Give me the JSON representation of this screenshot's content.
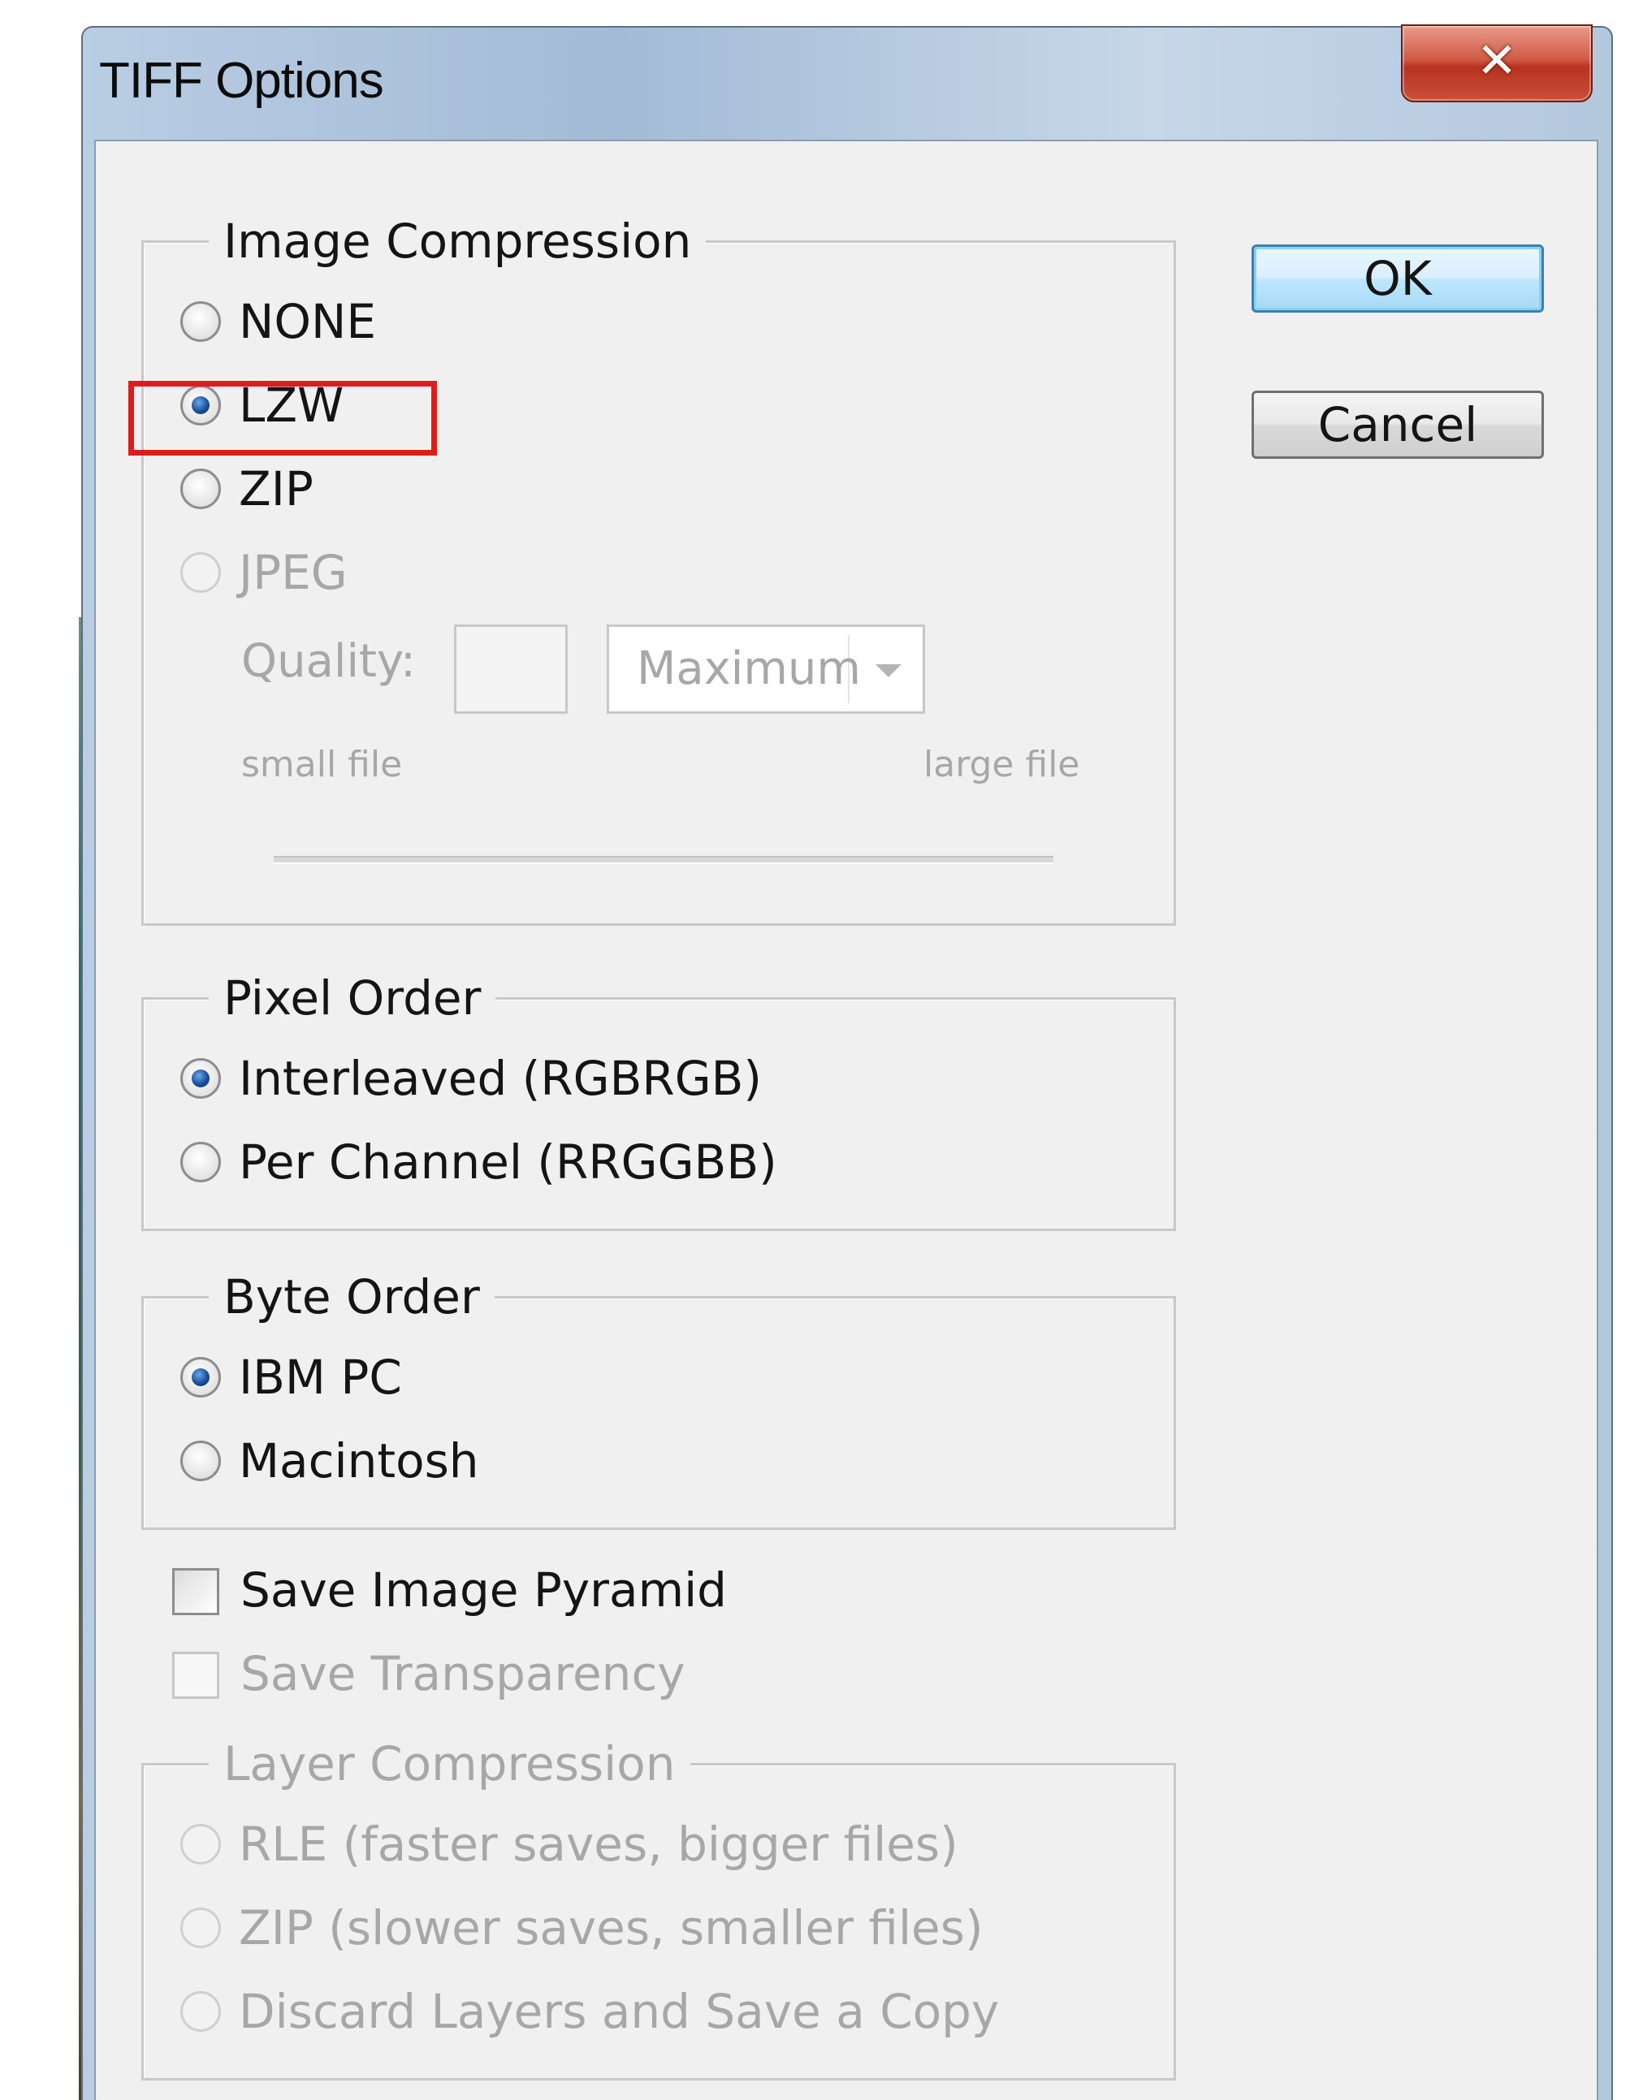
{
  "window": {
    "title": "TIFF Options",
    "close_glyph": "✕"
  },
  "buttons": {
    "ok": "OK",
    "cancel": "Cancel"
  },
  "image_compression": {
    "legend": "Image Compression",
    "options": [
      {
        "label": "NONE",
        "selected": false,
        "enabled": true
      },
      {
        "label": "LZW",
        "selected": true,
        "enabled": true
      },
      {
        "label": "ZIP",
        "selected": false,
        "enabled": true
      },
      {
        "label": "JPEG",
        "selected": false,
        "enabled": false
      }
    ],
    "quality_label": "Quality:",
    "quality_value": "",
    "quality_preset": "Maximum",
    "small_file_label": "small file",
    "large_file_label": "large file"
  },
  "pixel_order": {
    "legend": "Pixel Order",
    "options": [
      {
        "label": "Interleaved (RGBRGB)",
        "selected": true,
        "enabled": true
      },
      {
        "label": "Per Channel (RRGGBB)",
        "selected": false,
        "enabled": true
      }
    ]
  },
  "byte_order": {
    "legend": "Byte Order",
    "options": [
      {
        "label": "IBM PC",
        "selected": true,
        "enabled": true
      },
      {
        "label": "Macintosh",
        "selected": false,
        "enabled": true
      }
    ]
  },
  "checkboxes": [
    {
      "label": "Save Image Pyramid",
      "checked": false,
      "enabled": true
    },
    {
      "label": "Save Transparency",
      "checked": false,
      "enabled": false
    }
  ],
  "layer_compression": {
    "legend": "Layer Compression",
    "options": [
      {
        "label": "RLE (faster saves, bigger files)",
        "selected": false,
        "enabled": false
      },
      {
        "label": "ZIP (slower saves, smaller files)",
        "selected": false,
        "enabled": false
      },
      {
        "label": "Discard Layers and Save a Copy",
        "selected": false,
        "enabled": false
      }
    ]
  },
  "colors": {
    "highlight": "#e01b1b",
    "dialog_background": "#f0f0f0",
    "title_bar": "#a3bbd6",
    "close_button": "#c9503a"
  }
}
